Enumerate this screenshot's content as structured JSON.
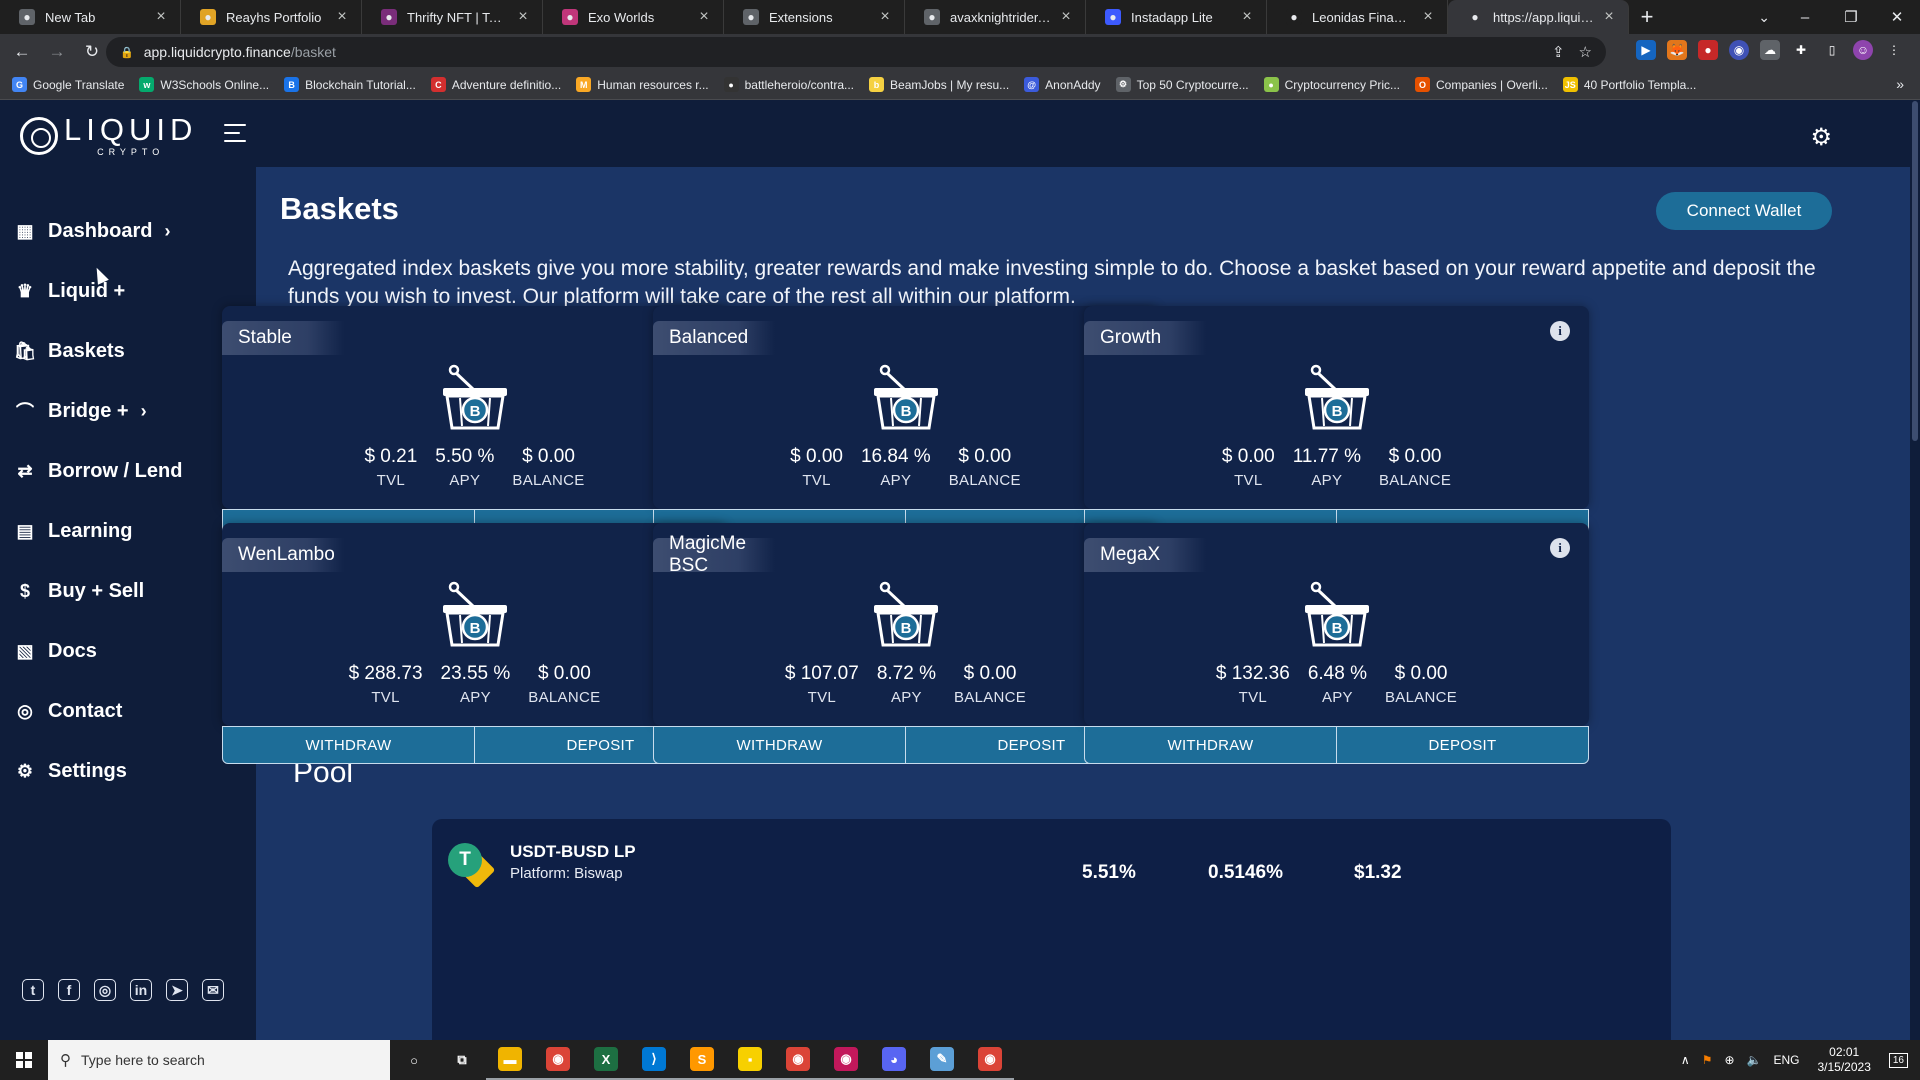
{
  "browser": {
    "tabs": [
      {
        "title": "New Tab",
        "icon": "chrome-icon",
        "color": "#5f6368"
      },
      {
        "title": "Reayhs Portfolio",
        "icon": "portfolio-icon",
        "color": "#e0a325"
      },
      {
        "title": "Thrifty NFT | Top Prod",
        "icon": "page-icon",
        "color": "#7a2d7a"
      },
      {
        "title": "Exo Worlds",
        "icon": "exo-icon",
        "color": "#c0367a"
      },
      {
        "title": "Extensions",
        "icon": "puzzle-icon",
        "color": "#5f6368"
      },
      {
        "title": "avaxknightrider.com",
        "icon": "globe-icon",
        "color": "#5f6368"
      },
      {
        "title": "Instadapp Lite",
        "icon": "instadapp-icon",
        "color": "#3d5afe"
      },
      {
        "title": "Leonidas Finance",
        "icon": "leonidas-icon",
        "color": "#1f1f1f"
      },
      {
        "title": "https://app.liquidcrypt",
        "icon": "loading-icon",
        "color": "#35363a"
      }
    ],
    "new_tab_label": "+",
    "url_host": "app.liquidcrypto.finance",
    "url_path": "/basket",
    "bookmarks": [
      {
        "label": "Google Translate",
        "color": "#4285f4",
        "glyph": "G"
      },
      {
        "label": "W3Schools Online...",
        "color": "#04aa6d",
        "glyph": "w"
      },
      {
        "label": "Blockchain Tutorial...",
        "color": "#1a73e8",
        "glyph": "B"
      },
      {
        "label": "Adventure definitio...",
        "color": "#d32f2f",
        "glyph": "C"
      },
      {
        "label": "Human resources r...",
        "color": "#f9a825",
        "glyph": "M"
      },
      {
        "label": "battleheroio/contra...",
        "color": "#333333",
        "glyph": "●"
      },
      {
        "label": "BeamJobs | My resu...",
        "color": "#f5d142",
        "glyph": "b"
      },
      {
        "label": "AnonAddy",
        "color": "#3b5bdb",
        "glyph": "@"
      },
      {
        "label": "Top 50 Cryptocurre...",
        "color": "#5f6368",
        "glyph": "⚙"
      },
      {
        "label": "Cryptocurrency Pric...",
        "color": "#8bc34a",
        "glyph": "●"
      },
      {
        "label": "Companies | Overli...",
        "color": "#e65100",
        "glyph": "O"
      },
      {
        "label": "40 Portfolio Templa...",
        "color": "#f0c000",
        "glyph": "JS"
      }
    ],
    "bookmarks_more": "»"
  },
  "app": {
    "logo_word": "LIQUID",
    "logo_sub": "CRYPTO",
    "nav": [
      {
        "label": "Dashboard",
        "icon": "dashboard-icon",
        "glyph": "▦",
        "chevron": true
      },
      {
        "label": "Liquid +",
        "icon": "liquid-icon",
        "glyph": "♛",
        "chevron": false
      },
      {
        "label": "Baskets",
        "icon": "bag-icon",
        "glyph": "🛍",
        "chevron": false
      },
      {
        "label": "Bridge +",
        "icon": "bridge-icon",
        "glyph": "⌒",
        "chevron": true
      },
      {
        "label": "Borrow / Lend",
        "icon": "borrow-icon",
        "glyph": "⇄",
        "chevron": false
      },
      {
        "label": "Learning",
        "icon": "learning-icon",
        "glyph": "▤",
        "chevron": false
      },
      {
        "label": "Buy + Sell",
        "icon": "buy-sell-icon",
        "glyph": "$",
        "chevron": false
      },
      {
        "label": "Docs",
        "icon": "docs-icon",
        "glyph": "▧",
        "chevron": false
      },
      {
        "label": "Contact",
        "icon": "contact-icon",
        "glyph": "◎",
        "chevron": false
      },
      {
        "label": "Settings",
        "icon": "settings-icon",
        "glyph": "⚙",
        "chevron": false
      }
    ],
    "social": [
      {
        "name": "twitter-icon",
        "glyph": "t"
      },
      {
        "name": "facebook-icon",
        "glyph": "f"
      },
      {
        "name": "instagram-icon",
        "glyph": "◎"
      },
      {
        "name": "linkedin-icon",
        "glyph": "in"
      },
      {
        "name": "telegram-icon",
        "glyph": "➤"
      },
      {
        "name": "mail-icon",
        "glyph": "✉"
      }
    ],
    "page_title": "Baskets",
    "connect_wallet": "Connect Wallet",
    "intro": "Aggregated index baskets give you more stability, greater rewards and make investing simple to do. Choose a basket based on your reward appetite and deposit the funds you wish to invest. Our platform will take care of the rest all within our platform.",
    "labels": {
      "tvl": "TVL",
      "apy": "APY",
      "balance": "BALANCE",
      "withdraw": "WITHDRAW",
      "deposit": "DEPOSIT"
    },
    "baskets": [
      {
        "name": "Stable",
        "tvl": "$ 0.21",
        "apy": "5.50 %",
        "balance": "$ 0.00"
      },
      {
        "name": "Balanced",
        "tvl": "$ 0.00",
        "apy": "16.84 %",
        "balance": "$ 0.00"
      },
      {
        "name": "Growth",
        "tvl": "$ 0.00",
        "apy": "11.77 %",
        "balance": "$ 0.00"
      },
      {
        "name": "WenLambo",
        "tvl": "$ 288.73",
        "apy": "23.55 %",
        "balance": "$ 0.00"
      },
      {
        "name": "MagicMe BSC",
        "tvl": "$ 107.07",
        "apy": "8.72 %",
        "balance": "$ 0.00"
      },
      {
        "name": "MegaX",
        "tvl": "$ 132.36",
        "apy": "6.48 %",
        "balance": "$ 0.00"
      }
    ],
    "pool_title": "Pool",
    "pool": {
      "name": "USDT-BUSD LP",
      "platform": "Platform: Biswap",
      "apy": "5.51%",
      "daily": "0.5146%",
      "value": "$1.32"
    }
  },
  "taskbar": {
    "search_placeholder": "Type here to search",
    "apps": [
      {
        "name": "cortana-icon",
        "glyph": "○",
        "color": "#202020"
      },
      {
        "name": "task-view-icon",
        "glyph": "⧉",
        "color": "#202020"
      },
      {
        "name": "file-explorer-icon",
        "glyph": "▬",
        "color": "#f0b400"
      },
      {
        "name": "chrome-icon",
        "glyph": "◉",
        "color": "#db4437"
      },
      {
        "name": "excel-icon",
        "glyph": "X",
        "color": "#1d6f42"
      },
      {
        "name": "vscode-icon",
        "glyph": "⟩",
        "color": "#0078d4"
      },
      {
        "name": "sublime-icon",
        "glyph": "S",
        "color": "#ff9800"
      },
      {
        "name": "sticky-notes-icon",
        "glyph": "▪",
        "color": "#f7d000"
      },
      {
        "name": "chrome-profile-icon",
        "glyph": "◉",
        "color": "#db4437"
      },
      {
        "name": "chrome-dev-icon",
        "glyph": "◉",
        "color": "#c2185b"
      },
      {
        "name": "discord-icon",
        "glyph": "◕",
        "color": "#5865f2"
      },
      {
        "name": "notepad-icon",
        "glyph": "✎",
        "color": "#5c9fd6"
      },
      {
        "name": "chrome-active-icon",
        "glyph": "◉",
        "color": "#db4437"
      }
    ],
    "lang": "ENG",
    "time": "02:01",
    "date": "3/15/2023",
    "notifications": "16"
  }
}
